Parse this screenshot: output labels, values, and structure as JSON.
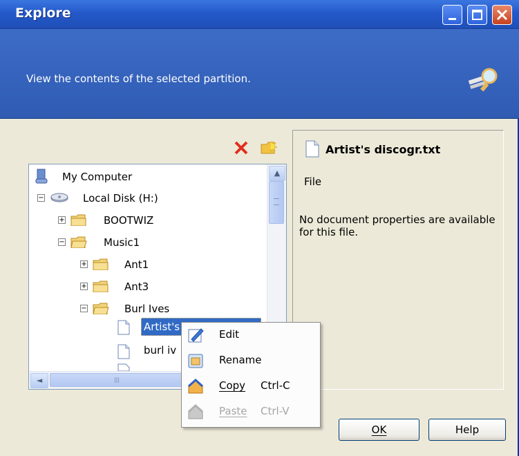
{
  "window": {
    "title": "Explore"
  },
  "header": {
    "subtitle": "View the contents of the selected partition."
  },
  "toolbar": {
    "delete_icon": "red-x-icon",
    "new_folder_icon": "new-folder-icon"
  },
  "tree": {
    "items": [
      {
        "label": "My Computer",
        "icon": "computer-icon"
      },
      {
        "label": "Local Disk (H:)",
        "icon": "disk-icon",
        "expander": "−"
      },
      {
        "label": "BOOTWIZ",
        "icon": "folder-icon",
        "expander": "+"
      },
      {
        "label": "Music1",
        "icon": "folder-icon",
        "expander": "−"
      },
      {
        "label": "Ant1",
        "icon": "folder-icon",
        "expander": "+"
      },
      {
        "label": "Ant3",
        "icon": "folder-icon",
        "expander": "+"
      },
      {
        "label": "Burl Ives",
        "icon": "folder-icon",
        "expander": "−"
      },
      {
        "label": "Artist's",
        "icon": "document-icon"
      },
      {
        "label": "burl iv",
        "icon": "document-icon"
      }
    ],
    "scroll": {
      "up": "▲",
      "left": "◄",
      "thumb_grip": "|||"
    }
  },
  "details": {
    "filename": "Artist's discogr.txt",
    "type": "File",
    "description": "No document properties are available for this file."
  },
  "context_menu": {
    "items": [
      {
        "label": "Edit",
        "shortcut": "",
        "enabled": true,
        "icon": "edit-pencil-icon"
      },
      {
        "label": "Rename",
        "shortcut": "",
        "enabled": true,
        "icon": "rename-icon"
      },
      {
        "label": "Copy",
        "shortcut": "Ctrl-C",
        "enabled": true,
        "icon": "copy-house-icon"
      },
      {
        "label": "Paste",
        "shortcut": "Ctrl-V",
        "enabled": false,
        "icon": "paste-house-icon"
      }
    ]
  },
  "buttons": {
    "ok": "OK",
    "help": "Help"
  },
  "colors": {
    "title_blue": "#2459c9",
    "header_blue": "#3d6cc7",
    "selection": "#316ac5",
    "close_red": "#c7401f"
  }
}
